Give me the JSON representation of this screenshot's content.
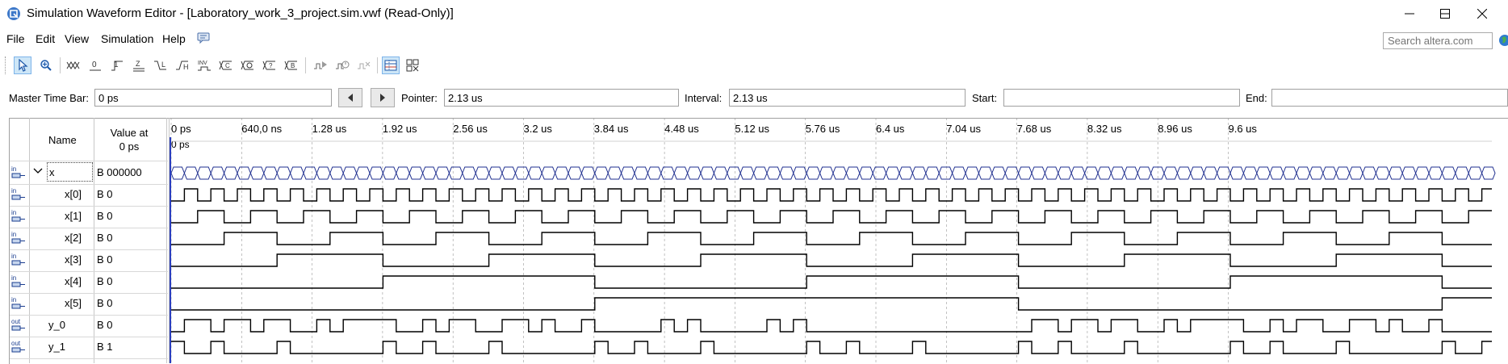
{
  "window": {
    "title": "Simulation Waveform Editor - [Laboratory_work_3_project.sim.vwf (Read-Only)]",
    "app_icon": "quartus-icon"
  },
  "menu": [
    "File",
    "Edit",
    "View",
    "Simulation",
    "Help"
  ],
  "search": {
    "placeholder": "Search altera.com"
  },
  "toolbar": {
    "tools": [
      "selection-tool-icon",
      "zoom-tool-icon",
      "force-unknown-icon",
      "force-low-icon",
      "force-high-icon",
      "force-high-impedance-icon",
      "force-weak-low-icon",
      "force-weak-high-icon",
      "invert-icon",
      "count-value-icon",
      "overwrite-clock-icon",
      "random-values-icon",
      "force-dont-care-icon",
      "weak-high-force-icon",
      "run-functional-simulation-icon",
      "run-timing-simulation-icon",
      "generate-netlist-icon",
      "snap-to-grid-icon",
      "sort-icon"
    ]
  },
  "timebar": {
    "master_label": "Master Time Bar:",
    "master_value": "0 ps",
    "pointer_label": "Pointer:",
    "pointer_value": "2.13 us",
    "interval_label": "Interval:",
    "interval_value": "2.13 us",
    "start_label": "Start:",
    "start_value": "",
    "end_label": "End:",
    "end_value": ""
  },
  "waveform": {
    "header_name": "Name",
    "header_value": "Value at",
    "header_value_time": "0 ps",
    "cursor_label": "0 ps",
    "ruler": [
      "0 ps",
      "640,0 ns",
      "1.28 us",
      "1.92 us",
      "2.56 us",
      "3.2 us",
      "3.84 us",
      "4.48 us",
      "5.12 us",
      "5.76 us",
      "6.4 us",
      "7.04 us",
      "7.68 us",
      "8.32 us",
      "8.96 us",
      "9.6 us"
    ],
    "signals": [
      {
        "name": "x",
        "value": "B 000000",
        "kind": "in",
        "group": true
      },
      {
        "name": "x[0]",
        "value": "B 0",
        "kind": "in"
      },
      {
        "name": "x[1]",
        "value": "B 0",
        "kind": "in"
      },
      {
        "name": "x[2]",
        "value": "B 0",
        "kind": "in"
      },
      {
        "name": "x[3]",
        "value": "B 0",
        "kind": "in"
      },
      {
        "name": "x[4]",
        "value": "B 0",
        "kind": "in"
      },
      {
        "name": "x[5]",
        "value": "B 0",
        "kind": "in"
      },
      {
        "name": "y_0",
        "value": "B 0",
        "kind": "out"
      },
      {
        "name": "y_1",
        "value": "B 1",
        "kind": "out"
      }
    ],
    "icon_labels": {
      "in": "in",
      "out": "out"
    },
    "colors": {
      "bus": "#1f2f8f",
      "signal": "#000000",
      "grid": "#9a9a9a",
      "cursor": "#2b3fbf"
    }
  }
}
